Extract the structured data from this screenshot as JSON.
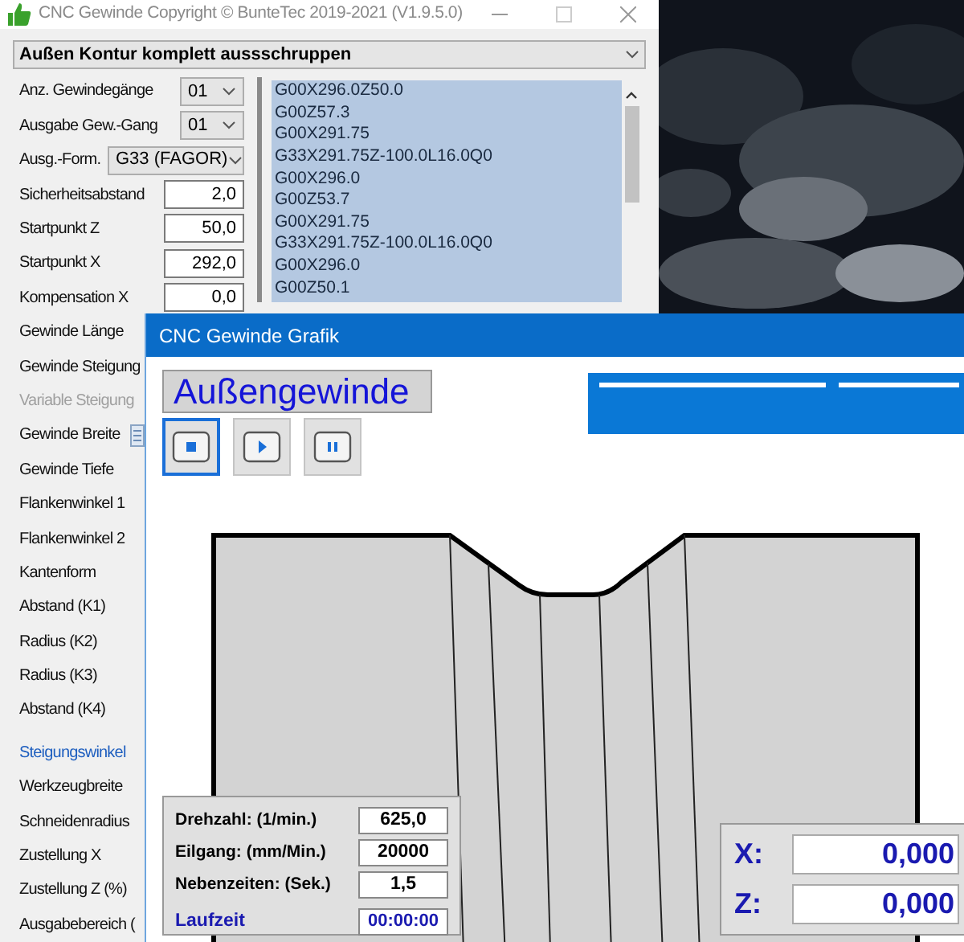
{
  "main_window": {
    "title": "CNC Gewinde Copyright © BunteTec 2019-2021 (V1.9.5.0)",
    "mode_select": {
      "value": "Außen Kontur komplett aussschruppen"
    },
    "parameters": [
      {
        "label": "Anz. Gewindegänge",
        "kind": "select",
        "value": "01"
      },
      {
        "label": "Ausgabe Gew.-Gang",
        "kind": "select",
        "value": "01"
      },
      {
        "label": "Ausg.-Form.",
        "kind": "wide-select",
        "value": "G33 (FAGOR)"
      },
      {
        "label": "Sicherheitsabstand",
        "kind": "input",
        "value": "2,0"
      },
      {
        "label": "Startpunkt Z",
        "kind": "input",
        "value": "50,0"
      },
      {
        "label": "Startpunkt X",
        "kind": "input",
        "value": "292,0"
      },
      {
        "label": "Kompensation X",
        "kind": "input",
        "value": "0,0"
      },
      {
        "label": "Gewinde Länge",
        "kind": "label"
      },
      {
        "label": "Gewinde Steigung",
        "kind": "label"
      },
      {
        "label": "Variable Steigung",
        "kind": "disabled-label"
      },
      {
        "label": "Gewinde Breite",
        "kind": "calc"
      },
      {
        "label": "Gewinde Tiefe",
        "kind": "label"
      },
      {
        "label": "Flankenwinkel 1",
        "kind": "label"
      },
      {
        "label": "Flankenwinkel 2",
        "kind": "label"
      },
      {
        "label": "Kantenform",
        "kind": "label"
      },
      {
        "label": "Abstand (K1)",
        "kind": "label"
      },
      {
        "label": "Radius (K2)",
        "kind": "label"
      },
      {
        "label": "Radius (K3)",
        "kind": "label"
      },
      {
        "label": "Abstand (K4)",
        "kind": "label"
      },
      {
        "label": "Steigungswinkel",
        "kind": "link"
      },
      {
        "label": "Werkzeugbreite",
        "kind": "label"
      },
      {
        "label": "Schneidenradius",
        "kind": "label"
      },
      {
        "label": "Zustellung X",
        "kind": "label"
      },
      {
        "label": "Zustellung Z (%)",
        "kind": "label"
      },
      {
        "label": "Ausgabebereich (",
        "kind": "label"
      }
    ],
    "program_listing": [
      "G00X296.0Z50.0",
      "G00Z57.3",
      "G00X291.75",
      "G33X291.75Z-100.0L16.0Q0",
      "G00X296.0",
      "G00Z53.7",
      "G00X291.75",
      "G33X291.75Z-100.0L16.0Q0",
      "G00X296.0",
      "G00Z50.1"
    ]
  },
  "graphic_window": {
    "title": "CNC Gewinde Grafik",
    "thread_type": "Außengewinde",
    "controls": [
      {
        "kind": "stop",
        "selected": true
      },
      {
        "kind": "play",
        "selected": false
      },
      {
        "kind": "pause",
        "selected": false
      }
    ],
    "machine": [
      {
        "label": "Drehzahl: (1/min.)",
        "value": "625,0"
      },
      {
        "label": "Eilgang: (mm/Min.)",
        "value": "20000"
      },
      {
        "label": "Nebenzeiten: (Sek.)",
        "value": "1,5"
      }
    ],
    "runtime": {
      "label": "Laufzeit",
      "value": "00:00:00"
    },
    "position": [
      {
        "axis": "X:",
        "value": "0,000"
      },
      {
        "axis": "Z:",
        "value": "0,000"
      }
    ]
  }
}
